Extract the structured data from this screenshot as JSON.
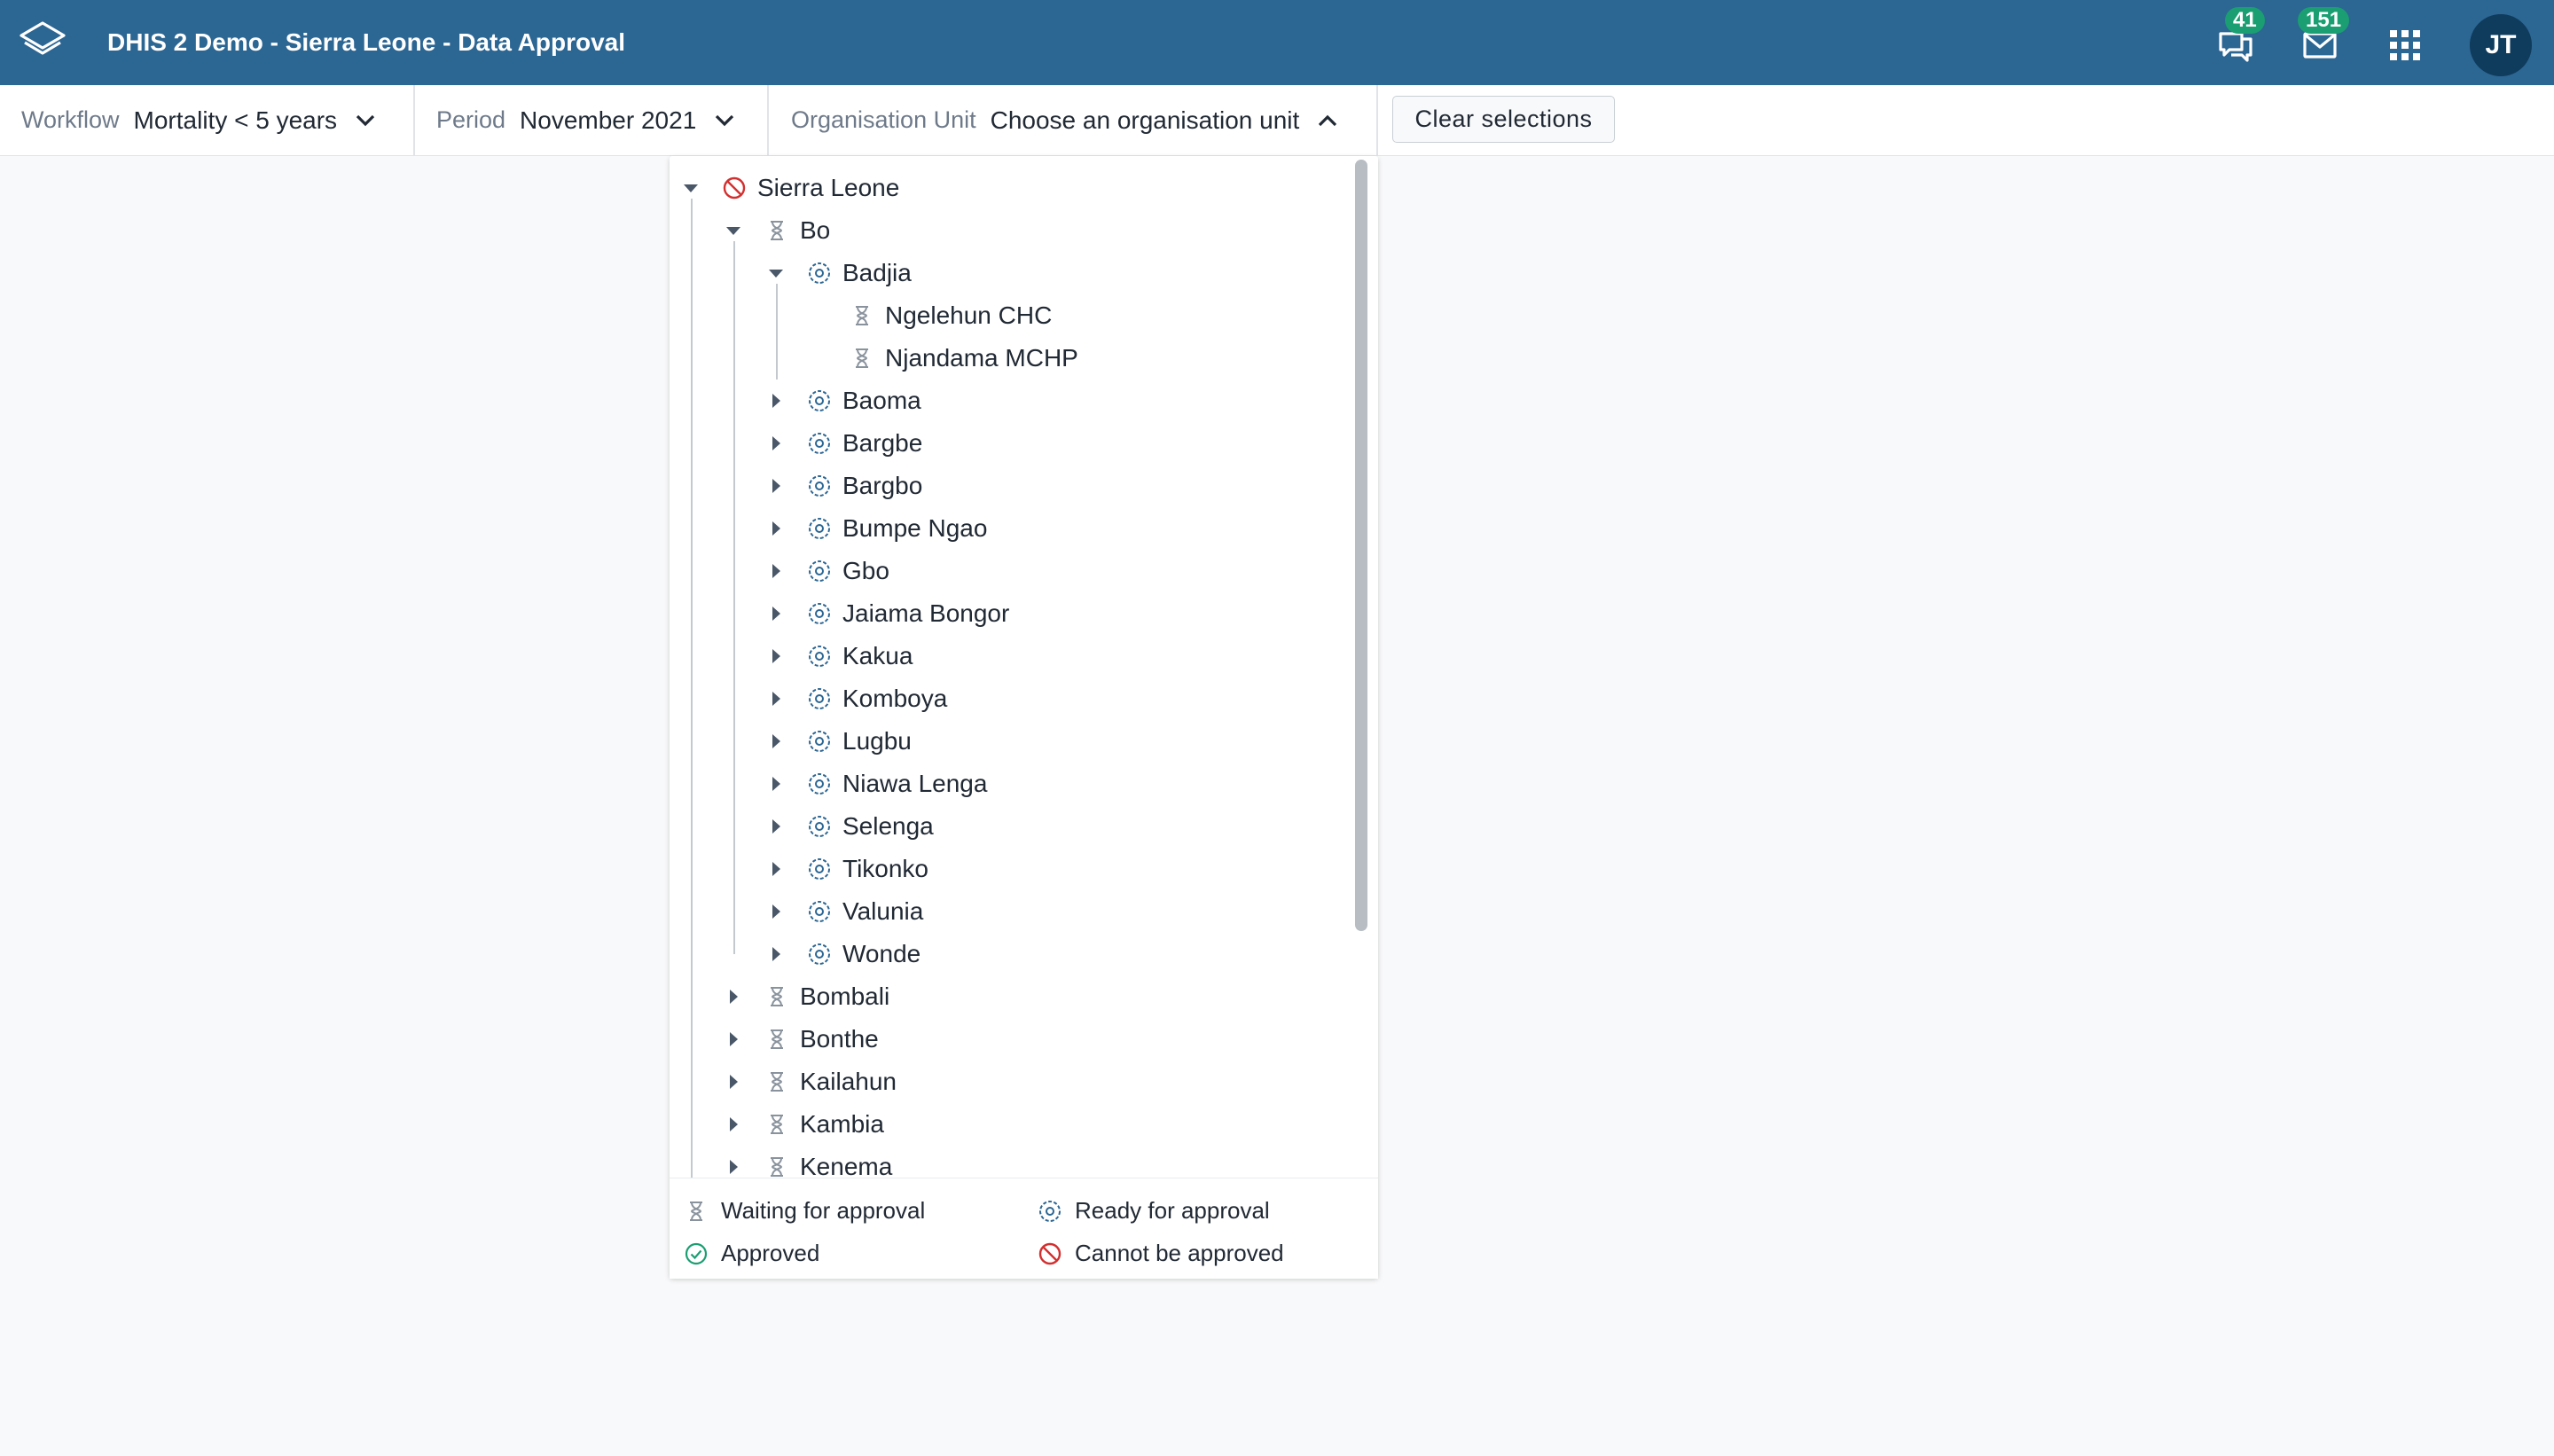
{
  "header": {
    "title": "DHIS 2 Demo - Sierra Leone - Data Approval",
    "interpretations_count": "41",
    "messages_count": "151",
    "user_initials": "JT",
    "colors": {
      "header_bg": "#2c6693",
      "badge": "#1a9e72",
      "avatar_bg": "#0f3b5c"
    }
  },
  "selection_bar": {
    "workflow_label": "Workflow",
    "workflow_value": "Mortality < 5 years",
    "period_label": "Period",
    "period_value": "November 2021",
    "orgunit_label": "Organisation Unit",
    "orgunit_value": "Choose an organisation unit",
    "clear_label": "Clear selections"
  },
  "tree": [
    {
      "label": "Sierra Leone",
      "level": 0,
      "toggle": "expanded",
      "status": "cannot"
    },
    {
      "label": "Bo",
      "level": 1,
      "toggle": "expanded",
      "status": "waiting"
    },
    {
      "label": "Badjia",
      "level": 2,
      "toggle": "expanded",
      "status": "ready"
    },
    {
      "label": "Ngelehun CHC",
      "level": 3,
      "toggle": "none",
      "status": "waiting"
    },
    {
      "label": "Njandama MCHP",
      "level": 3,
      "toggle": "none",
      "status": "waiting"
    },
    {
      "label": "Baoma",
      "level": 2,
      "toggle": "collapsed",
      "status": "ready"
    },
    {
      "label": "Bargbe",
      "level": 2,
      "toggle": "collapsed",
      "status": "ready"
    },
    {
      "label": "Bargbo",
      "level": 2,
      "toggle": "collapsed",
      "status": "ready"
    },
    {
      "label": "Bumpe Ngao",
      "level": 2,
      "toggle": "collapsed",
      "status": "ready"
    },
    {
      "label": "Gbo",
      "level": 2,
      "toggle": "collapsed",
      "status": "ready"
    },
    {
      "label": "Jaiama Bongor",
      "level": 2,
      "toggle": "collapsed",
      "status": "ready"
    },
    {
      "label": "Kakua",
      "level": 2,
      "toggle": "collapsed",
      "status": "ready"
    },
    {
      "label": "Komboya",
      "level": 2,
      "toggle": "collapsed",
      "status": "ready"
    },
    {
      "label": "Lugbu",
      "level": 2,
      "toggle": "collapsed",
      "status": "ready"
    },
    {
      "label": "Niawa Lenga",
      "level": 2,
      "toggle": "collapsed",
      "status": "ready"
    },
    {
      "label": "Selenga",
      "level": 2,
      "toggle": "collapsed",
      "status": "ready"
    },
    {
      "label": "Tikonko",
      "level": 2,
      "toggle": "collapsed",
      "status": "ready"
    },
    {
      "label": "Valunia",
      "level": 2,
      "toggle": "collapsed",
      "status": "ready"
    },
    {
      "label": "Wonde",
      "level": 2,
      "toggle": "collapsed",
      "status": "ready"
    },
    {
      "label": "Bombali",
      "level": 1,
      "toggle": "collapsed",
      "status": "waiting"
    },
    {
      "label": "Bonthe",
      "level": 1,
      "toggle": "collapsed",
      "status": "waiting"
    },
    {
      "label": "Kailahun",
      "level": 1,
      "toggle": "collapsed",
      "status": "waiting"
    },
    {
      "label": "Kambia",
      "level": 1,
      "toggle": "collapsed",
      "status": "waiting"
    },
    {
      "label": "Kenema",
      "level": 1,
      "toggle": "collapsed",
      "status": "waiting"
    }
  ],
  "legend": {
    "waiting": "Waiting for approval",
    "ready": "Ready for approval",
    "approved": "Approved",
    "cannot": "Cannot be approved"
  },
  "status_colors": {
    "waiting": "#8a939d",
    "ready": "#2c6693",
    "approved": "#1a9e72",
    "cannot": "#d32f2f"
  }
}
